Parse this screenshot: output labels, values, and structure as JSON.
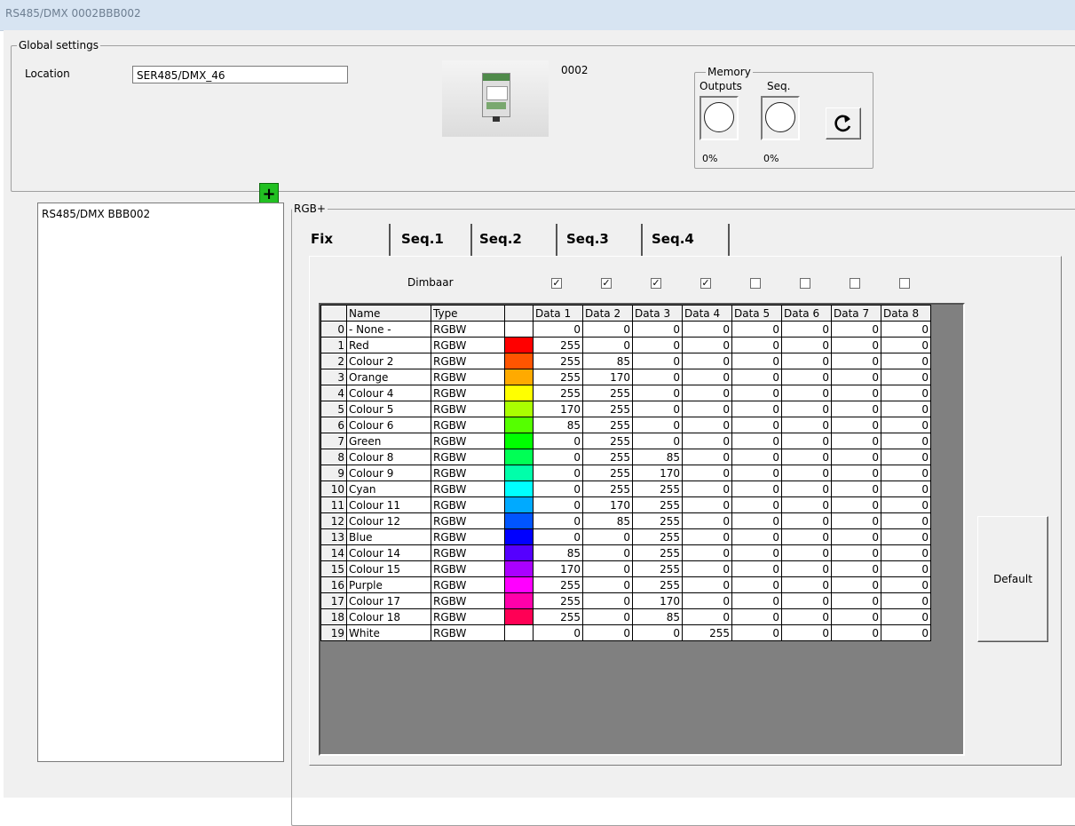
{
  "window": {
    "title": "RS485/DMX 0002BBB002"
  },
  "global": {
    "group_label": "Global settings",
    "location_label": "Location",
    "location_value": "SER485/DMX_46",
    "device_code": "0002"
  },
  "memory": {
    "group_label": "Memory",
    "outputs_label": "Outputs",
    "seq_label": "Seq.",
    "outputs_pct": "0%",
    "seq_pct": "0%",
    "refresh_icon": "refresh-icon"
  },
  "add_button_label": "+",
  "module_list": [
    "RS485/DMX BBB002"
  ],
  "rgb": {
    "group_label": "RGB+",
    "tabs": [
      "Fix",
      "Seq.1",
      "Seq.2",
      "Seq.3",
      "Seq.4"
    ],
    "dimbaar_label": "Dimbaar",
    "dimbaar": [
      true,
      true,
      true,
      true,
      false,
      false,
      false,
      false
    ],
    "default_label": "Default",
    "columns": [
      "Name",
      "Type",
      "",
      "Data 1",
      "Data 2",
      "Data 3",
      "Data 4",
      "Data 5",
      "Data 6",
      "Data 7",
      "Data 8"
    ],
    "rows": [
      {
        "idx": "0",
        "name": "- None -",
        "type": "RGBW",
        "color": "#ffffff",
        "d": [
          "0",
          "0",
          "0",
          "0",
          "0",
          "0",
          "0",
          "0"
        ]
      },
      {
        "idx": "1",
        "name": "Red",
        "type": "RGBW",
        "color": "#ff0000",
        "d": [
          "255",
          "0",
          "0",
          "0",
          "0",
          "0",
          "0",
          "0"
        ]
      },
      {
        "idx": "2",
        "name": "Colour 2",
        "type": "RGBW",
        "color": "#ff5500",
        "d": [
          "255",
          "85",
          "0",
          "0",
          "0",
          "0",
          "0",
          "0"
        ]
      },
      {
        "idx": "3",
        "name": "Orange",
        "type": "RGBW",
        "color": "#ffaa00",
        "d": [
          "255",
          "170",
          "0",
          "0",
          "0",
          "0",
          "0",
          "0"
        ]
      },
      {
        "idx": "4",
        "name": "Colour 4",
        "type": "RGBW",
        "color": "#ffff00",
        "d": [
          "255",
          "255",
          "0",
          "0",
          "0",
          "0",
          "0",
          "0"
        ]
      },
      {
        "idx": "5",
        "name": "Colour 5",
        "type": "RGBW",
        "color": "#aaff00",
        "d": [
          "170",
          "255",
          "0",
          "0",
          "0",
          "0",
          "0",
          "0"
        ]
      },
      {
        "idx": "6",
        "name": "Colour 6",
        "type": "RGBW",
        "color": "#55ff00",
        "d": [
          "85",
          "255",
          "0",
          "0",
          "0",
          "0",
          "0",
          "0"
        ]
      },
      {
        "idx": "7",
        "name": "Green",
        "type": "RGBW",
        "color": "#00ff00",
        "d": [
          "0",
          "255",
          "0",
          "0",
          "0",
          "0",
          "0",
          "0"
        ]
      },
      {
        "idx": "8",
        "name": "Colour 8",
        "type": "RGBW",
        "color": "#00ff55",
        "d": [
          "0",
          "255",
          "85",
          "0",
          "0",
          "0",
          "0",
          "0"
        ]
      },
      {
        "idx": "9",
        "name": "Colour 9",
        "type": "RGBW",
        "color": "#00ffaa",
        "d": [
          "0",
          "255",
          "170",
          "0",
          "0",
          "0",
          "0",
          "0"
        ]
      },
      {
        "idx": "10",
        "name": "Cyan",
        "type": "RGBW",
        "color": "#00ffff",
        "d": [
          "0",
          "255",
          "255",
          "0",
          "0",
          "0",
          "0",
          "0"
        ]
      },
      {
        "idx": "11",
        "name": "Colour 11",
        "type": "RGBW",
        "color": "#00aaff",
        "d": [
          "0",
          "170",
          "255",
          "0",
          "0",
          "0",
          "0",
          "0"
        ]
      },
      {
        "idx": "12",
        "name": "Colour 12",
        "type": "RGBW",
        "color": "#0055ff",
        "d": [
          "0",
          "85",
          "255",
          "0",
          "0",
          "0",
          "0",
          "0"
        ]
      },
      {
        "idx": "13",
        "name": "Blue",
        "type": "RGBW",
        "color": "#0000ff",
        "d": [
          "0",
          "0",
          "255",
          "0",
          "0",
          "0",
          "0",
          "0"
        ]
      },
      {
        "idx": "14",
        "name": "Colour 14",
        "type": "RGBW",
        "color": "#5500ff",
        "d": [
          "85",
          "0",
          "255",
          "0",
          "0",
          "0",
          "0",
          "0"
        ]
      },
      {
        "idx": "15",
        "name": "Colour 15",
        "type": "RGBW",
        "color": "#aa00ff",
        "d": [
          "170",
          "0",
          "255",
          "0",
          "0",
          "0",
          "0",
          "0"
        ]
      },
      {
        "idx": "16",
        "name": "Purple",
        "type": "RGBW",
        "color": "#ff00ff",
        "d": [
          "255",
          "0",
          "255",
          "0",
          "0",
          "0",
          "0",
          "0"
        ]
      },
      {
        "idx": "17",
        "name": "Colour 17",
        "type": "RGBW",
        "color": "#ff00aa",
        "d": [
          "255",
          "0",
          "170",
          "0",
          "0",
          "0",
          "0",
          "0"
        ]
      },
      {
        "idx": "18",
        "name": "Colour 18",
        "type": "RGBW",
        "color": "#ff0055",
        "d": [
          "255",
          "0",
          "85",
          "0",
          "0",
          "0",
          "0",
          "0"
        ]
      },
      {
        "idx": "19",
        "name": "White",
        "type": "RGBW",
        "color": "#ffffff",
        "d": [
          "0",
          "0",
          "0",
          "255",
          "0",
          "0",
          "0",
          "0"
        ]
      }
    ]
  }
}
